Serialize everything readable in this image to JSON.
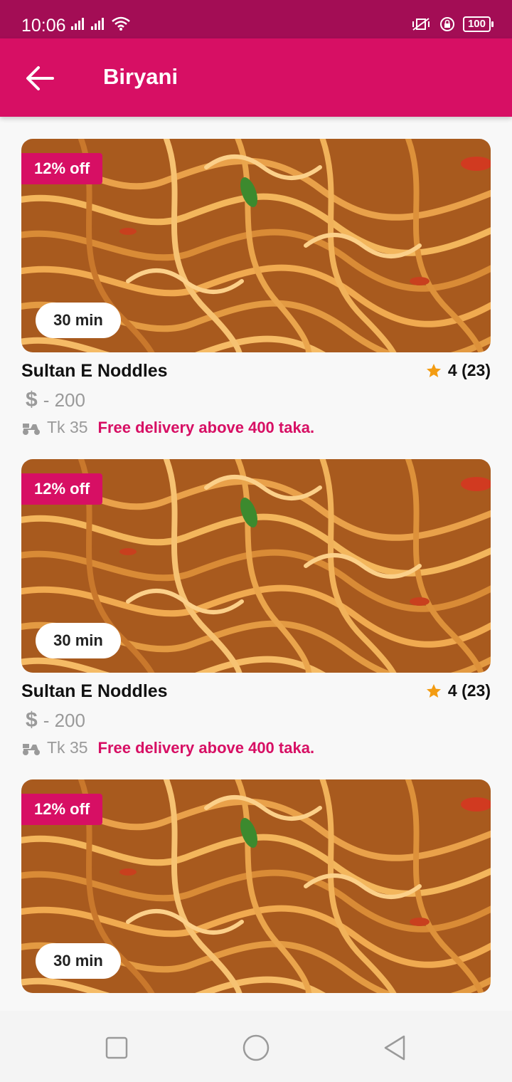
{
  "status_bar": {
    "time": "10:06",
    "battery": "100",
    "icons": [
      "signal-icon",
      "signal-icon",
      "wifi-icon",
      "vibrate-icon",
      "rotation-lock-icon",
      "battery-icon"
    ]
  },
  "app_bar": {
    "title": "Biryani",
    "back_icon": "arrow-left-icon"
  },
  "colors": {
    "brand": "#d70f64",
    "status_bar": "#a30d55",
    "star": "#f39c12",
    "muted": "#9a9a9a"
  },
  "restaurants": [
    {
      "discount": "12% off",
      "delivery_time": "30 min",
      "name": "Sultan E Noddles",
      "rating": "4 (23)",
      "price_symbol": "$",
      "price": "- 200",
      "delivery_fee": "Tk 35",
      "free_delivery": "Free delivery above 400 taka."
    },
    {
      "discount": "12% off",
      "delivery_time": "30 min",
      "name": "Sultan E Noddles",
      "rating": "4 (23)",
      "price_symbol": "$",
      "price": "- 200",
      "delivery_fee": "Tk 35",
      "free_delivery": "Free delivery above 400 taka."
    },
    {
      "discount": "12% off",
      "delivery_time": "30 min"
    }
  ],
  "nav_bar": {
    "icons": [
      "recent-apps-icon",
      "home-icon",
      "back-icon"
    ]
  }
}
